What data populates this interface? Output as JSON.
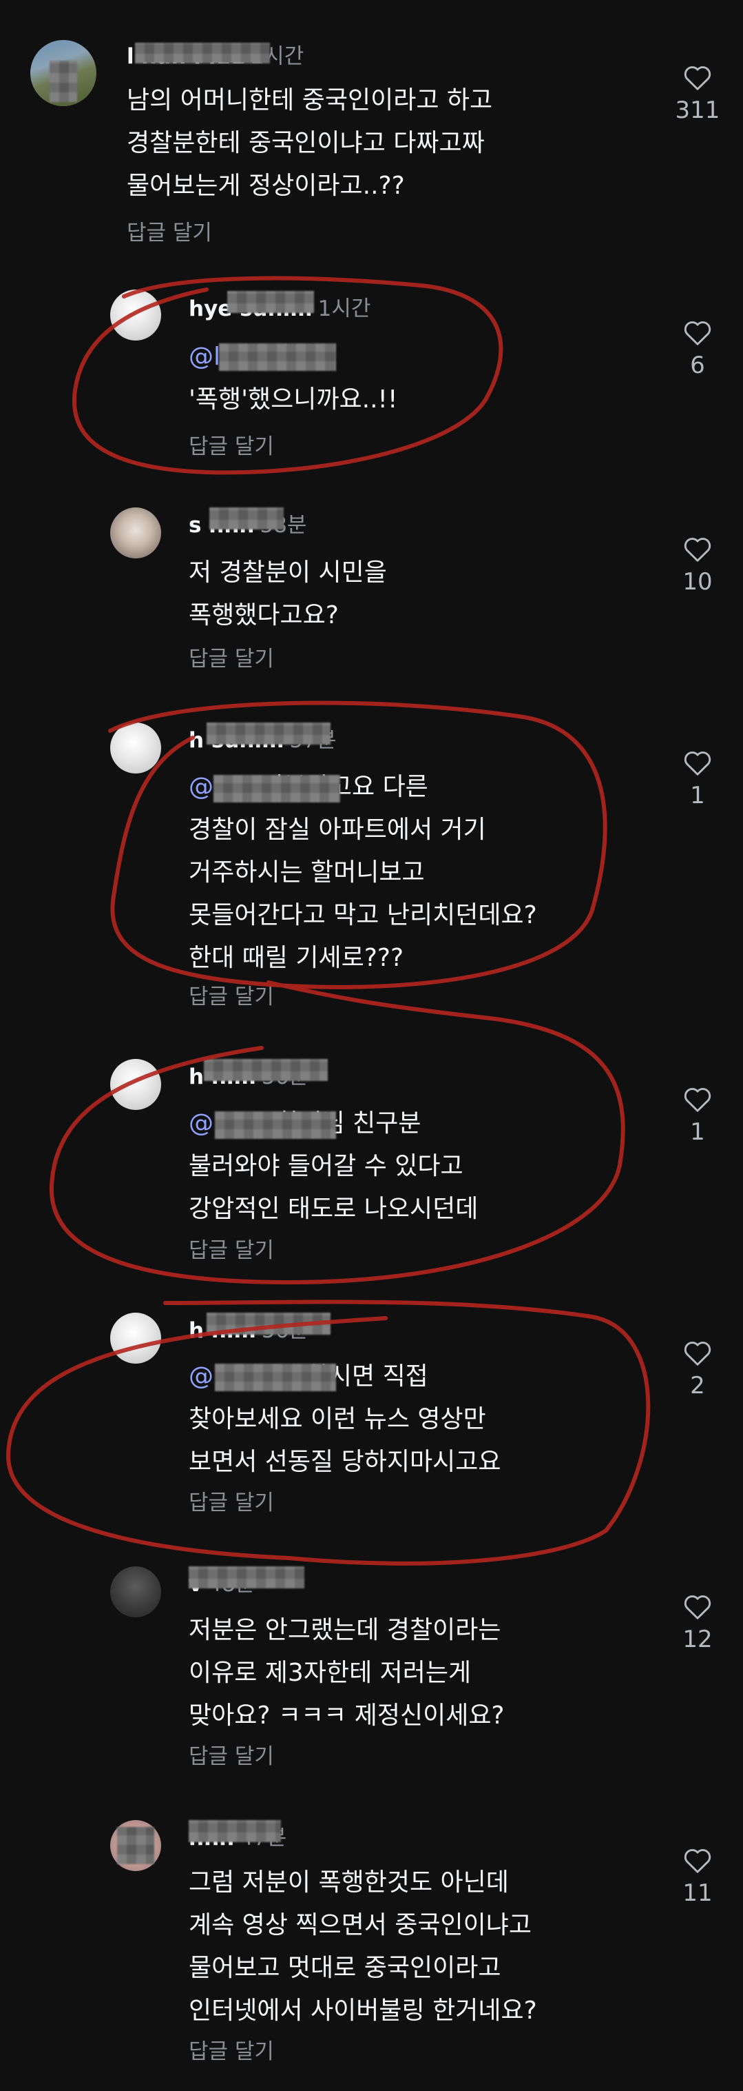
{
  "colors": {
    "background": "#101010",
    "text": "#f3f5f7",
    "muted": "#8b8e93",
    "mention": "#8fa2ff",
    "annotation": "#b3261e"
  },
  "icons": {
    "like": "heart-outline-icon"
  },
  "reply_label": "답글 달기",
  "comments": [
    {
      "username": "l nan l l11",
      "time": "2시간",
      "mention": "",
      "text": "남의 어머니한테 중국인이라고 하고\n경찰분한테 중국인이냐고 다짜고짜\n물어보는게 정상이라고..??",
      "likes": "311"
    },
    {
      "username": "hye sunim",
      "time": "1시간",
      "mention": "@l 11",
      "text": " 시민을\n'폭행'했으니까요..!!",
      "likes": "6"
    },
    {
      "username": "s hhh",
      "time": "58분",
      "mention": "",
      "text": "저 경찰분이 시민을\n폭행했다고요?",
      "likes": "10"
    },
    {
      "username": "h sunim",
      "time": "57분",
      "mention": "@ hh",
      "text": " 저분말고요 다른\n경찰이 잠실 아파트에서 거기\n거주하시는 할머니보고\n못들어간다고 막고 난리치던데요?\n한대 때릴 기세로???",
      "likes": "1"
    },
    {
      "username": "h nim",
      "time": "56분",
      "mention": "@ hhh",
      "text": " 할머님 친구분\n불러와야 들어갈 수 있다고\n강압적인 태도로 나오시던데",
      "likes": "1"
    },
    {
      "username": "h nim",
      "time": "56분",
      "mention": "@ hh",
      "text": " 궁금하시면 직접\n찾아보세요 이런 뉴스 영상만\n보면서 선동질 당하지마시고요",
      "likes": "2"
    },
    {
      "username": "v",
      "time": "48분",
      "mention": "",
      "text": "저분은 안그랬는데 경찰이라는\n이유로 제3자한테 저러는게\n맞아요? ㅋㅋㅋ 제정신이세요?",
      "likes": "12"
    },
    {
      "username": "hhh",
      "time": "47분",
      "mention": "",
      "text": "그럼 저분이 폭행한것도 아닌데\n계속 영상 찍으면서 중국인이냐고\n물어보고 멋대로 중국인이라고\n인터넷에서 사이버불링 한거네요?",
      "likes": "11"
    }
  ]
}
